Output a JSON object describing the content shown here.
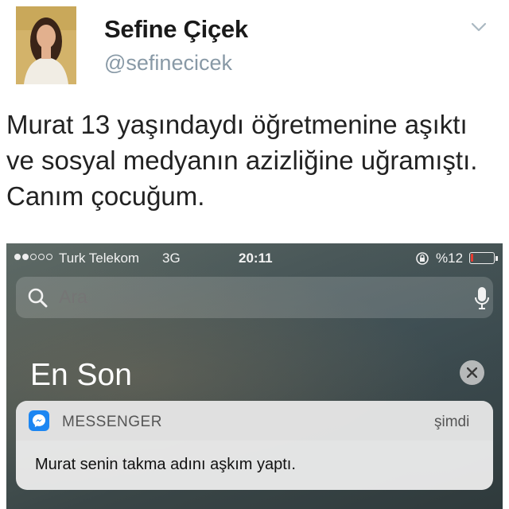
{
  "tweet": {
    "display_name": "Sefine Çiçek",
    "handle": "@sefinecicek",
    "text": "Murat 13 yaşındaydı öğretmenine aşıktı ve sosyal medyanın azizliğine uğramıştı. Canım çocuğum.",
    "menu_icon": "chevron-down-icon"
  },
  "phone": {
    "status_bar": {
      "carrier": "Turk Telekom",
      "network": "3G",
      "time": "20:11",
      "battery": "%12",
      "battery_level": 0.12,
      "signal_bars_filled": 2,
      "signal_bars_total": 5
    },
    "search": {
      "placeholder": "Ara"
    },
    "section_title": "En Son",
    "notification": {
      "app": "MESSENGER",
      "time": "şimdi",
      "message": "Murat senin takma adını aşkım yaptı."
    }
  },
  "colors": {
    "handle_gray": "#8899a6",
    "messenger_blue": "#1c86f2",
    "battery_red": "#e53b30"
  }
}
